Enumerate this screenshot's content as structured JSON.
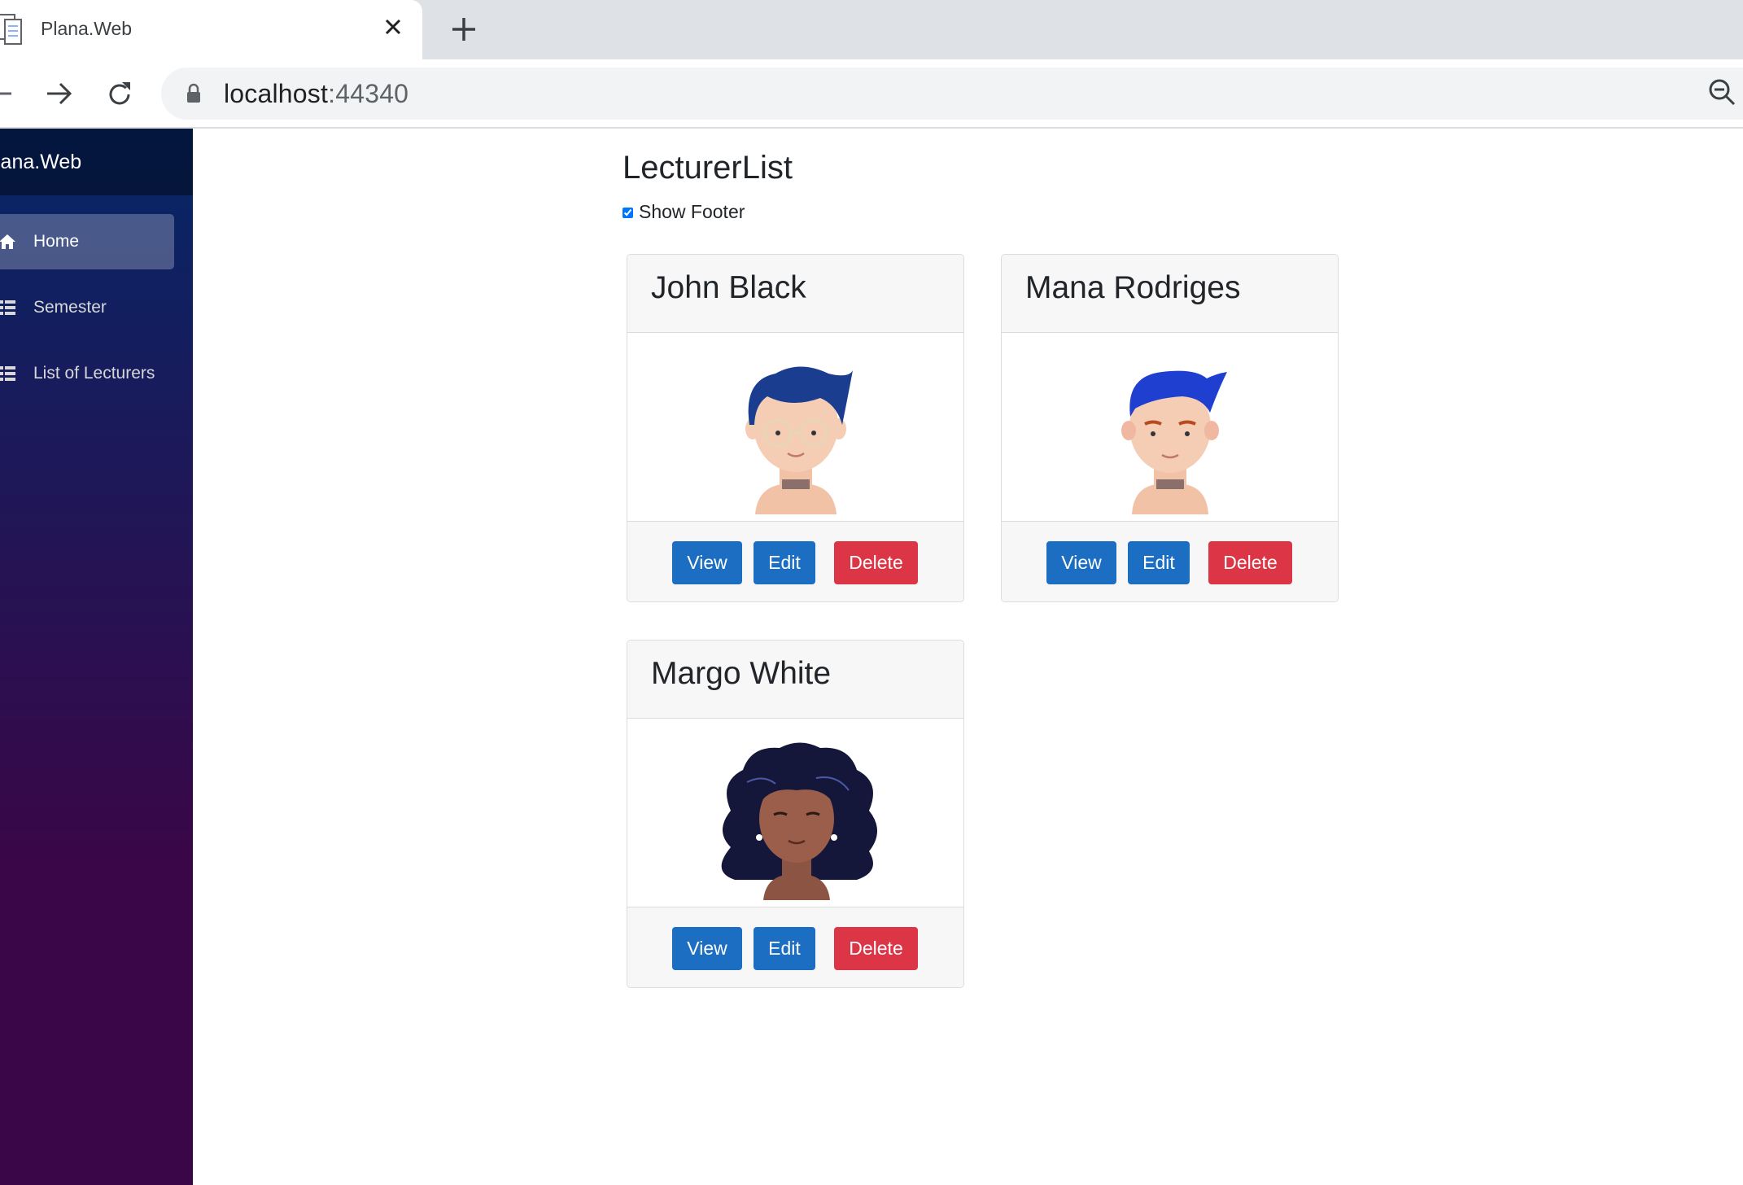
{
  "browser": {
    "tab_title": "Plana.Web",
    "url_host": "localhost",
    "url_port": ":44340",
    "icons": [
      "file-icon",
      "close-icon",
      "plus-icon",
      "back-arrow-icon",
      "forward-arrow-icon",
      "reload-icon",
      "lock-icon",
      "zoom-icon"
    ]
  },
  "sidebar": {
    "brand": "lana.Web",
    "items": [
      {
        "label": "Home",
        "icon": "home-icon",
        "active": true
      },
      {
        "label": "Semester",
        "icon": "list-icon",
        "active": false
      },
      {
        "label": "List of Lecturers",
        "icon": "list-icon",
        "active": false
      }
    ],
    "colors": {
      "gradient_top": "#052767",
      "gradient_bottom": "#3a0647"
    }
  },
  "main": {
    "title": "LecturerList",
    "show_footer_label": "Show Footer",
    "show_footer_checked": true,
    "lecturers": [
      {
        "name": "John Black",
        "avatar": "male-avatar-glasses"
      },
      {
        "name": "Mana Rodriges",
        "avatar": "male-avatar-blue-hair"
      },
      {
        "name": "Margo White",
        "avatar": "female-avatar-curly-hair"
      }
    ],
    "buttons": {
      "view": "View",
      "edit": "Edit",
      "delete": "Delete"
    },
    "colors": {
      "primary": "#1b6ec2",
      "danger": "#dc3545"
    }
  }
}
